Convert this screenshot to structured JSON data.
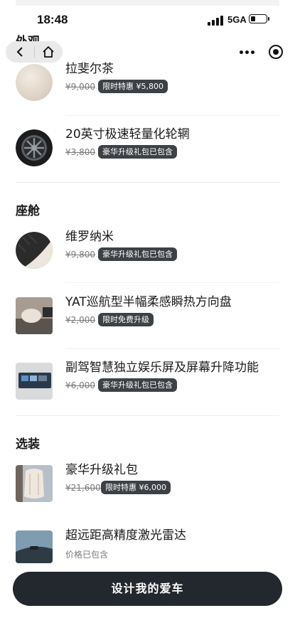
{
  "status_bar": {
    "time": "18:48",
    "network": "5GA"
  },
  "nav": {
    "back_icon": "chevron-left-icon",
    "home_icon": "home-icon",
    "more_icon": "more-dots-icon",
    "target_icon": "record-target-icon"
  },
  "sections": {
    "exterior": "外观",
    "cabin": "座舱",
    "options": "选装"
  },
  "items": {
    "exterior_paint": {
      "name": "拉斐尔茶",
      "price": "¥9,000",
      "badge": "限时特惠 ¥5,800"
    },
    "wheels": {
      "name": "20英寸极速轻量化轮辋",
      "price": "¥3,800",
      "badge": "豪华升级礼包已包含"
    },
    "interior": {
      "name": "维罗纳米",
      "price": "¥9,800",
      "badge": "豪华升级礼包已包含"
    },
    "yoke": {
      "name": "YAT巡航型半幅柔感瞬热方向盘",
      "price": "¥2,000",
      "badge": "限时免费升级"
    },
    "passenger_screen": {
      "name": "副驾智慧独立娱乐屏及屏幕升降功能",
      "price": "¥6,000",
      "badge": "豪华升级礼包已包含"
    },
    "luxury_pack": {
      "name": "豪华升级礼包",
      "price": "¥21,600",
      "badge": "限时特惠 ¥6,000"
    },
    "lidar": {
      "name": "超远距高精度激光雷达",
      "note": "价格已包含"
    }
  },
  "cta": {
    "label": "设计我的爱车"
  },
  "colors": {
    "badge_bg": "#3d4146",
    "cta_bg": "#23272e"
  }
}
